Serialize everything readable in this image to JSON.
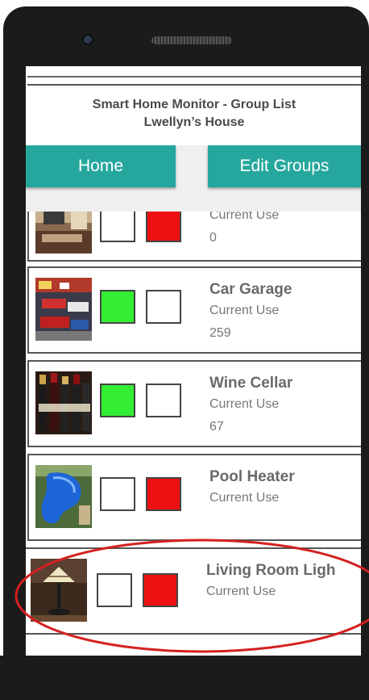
{
  "header": {
    "title": "Smart Home Monitor - Group List",
    "subtitle": "Lwellyn’s House"
  },
  "buttons": {
    "home": "Home",
    "edit_groups": "Edit Groups"
  },
  "groups": [
    {
      "name": "",
      "current_use_label": "Current Use",
      "current_use": "0",
      "on": false,
      "off": true,
      "image": "living-room-photo"
    },
    {
      "name": "Car Garage",
      "current_use_label": "Current Use",
      "current_use": "259",
      "on": true,
      "off": false,
      "image": "garage-photo"
    },
    {
      "name": "Wine Cellar",
      "current_use_label": "Current Use",
      "current_use": "67",
      "on": true,
      "off": false,
      "image": "wine-bottles-photo"
    },
    {
      "name": "Pool Heater",
      "current_use_label": "Current Use",
      "current_use": "",
      "on": false,
      "off": true,
      "image": "pool-photo"
    },
    {
      "name": "Living Room Ligh",
      "current_use_label": "Current Use",
      "current_use": "",
      "on": false,
      "off": true,
      "image": "lamp-photo"
    }
  ],
  "colors": {
    "accent": "#26a79d",
    "on": "#33ee33",
    "off": "#ee1111",
    "annotation": "#d42020"
  }
}
